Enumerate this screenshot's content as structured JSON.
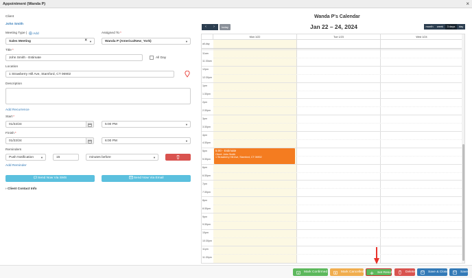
{
  "window": {
    "title": "Appointment (Wanda P)",
    "close": "×"
  },
  "form": {
    "client_label": "Client",
    "client_name": "John Smith",
    "meeting_type_label": "Meeting Type",
    "add_link": "Add",
    "meeting_type_value": "Sales Meeting",
    "assigned_to_label": "Assigned To",
    "assigned_to_value": "Wanda P (America/New_York)",
    "title_label": "Title",
    "title_value": "John Smith - Estimate",
    "all_day_label": "All Day",
    "location_label": "Location",
    "location_value": "1 Strawberry Hill Ave, Stamford, CT 06902",
    "description_label": "Description",
    "description_value": "",
    "add_recurrence": "Add Recurrence",
    "start_label": "Start",
    "start_date": "01/22/24",
    "start_time": "5:00 PM",
    "finish_label": "Finish",
    "finish_date": "01/22/24",
    "finish_time": "6:00 PM",
    "reminders_label": "Reminders",
    "reminder_type": "Push Notification",
    "reminder_amount": "15",
    "reminder_unit": "minutes before",
    "add_reminder": "Add Reminder",
    "send_sms": "Send Now Via SMS",
    "send_email": "Send Now Via Email",
    "client_contact_info": "Client Contact Info",
    "required_mark": "*"
  },
  "calendar": {
    "title": "Wanda P's Calendar",
    "range": "Jan 22 – 24, 2024",
    "today": "today",
    "prev": "‹",
    "next": "›",
    "views": [
      "month",
      "week",
      "3 days",
      "day"
    ],
    "active_view": "3 days",
    "columns": [
      "Mon 1/22",
      "Tue 1/23",
      "Wed 1/24"
    ],
    "all_day": "all-day",
    "times": [
      "11am",
      "11:30am",
      "12pm",
      "12:30pm",
      "1pm",
      "1:30pm",
      "2pm",
      "2:30pm",
      "3pm",
      "3:30pm",
      "4pm",
      "4:30pm",
      "5pm",
      "5:30pm",
      "6pm",
      "6:30pm",
      "7pm",
      "7:30pm",
      "8pm",
      "8:30pm",
      "9pm",
      "9:30pm",
      "10pm",
      "10:30pm",
      "11pm",
      "11:30pm"
    ],
    "event": {
      "time": "5:00 - Estimate",
      "client": "Client: John Smith",
      "address": "1 Strawberry Hill Ave, Stamford, CT 06902",
      "color": "#f47c20"
    }
  },
  "footer": {
    "mark_confirmed": "Mark Confirmed",
    "mark_cancelled": "Mark Cancelled",
    "set_result": "Set Result",
    "delete": "Delete",
    "save_close": "Save & Close",
    "save": "Save"
  },
  "colors": {
    "confirmed": "#5cb85c",
    "cancelled": "#f0ad4e",
    "set_result": "#5cb85c",
    "delete": "#d9534f",
    "save": "#337ab7",
    "arrow": "#e8322a"
  }
}
